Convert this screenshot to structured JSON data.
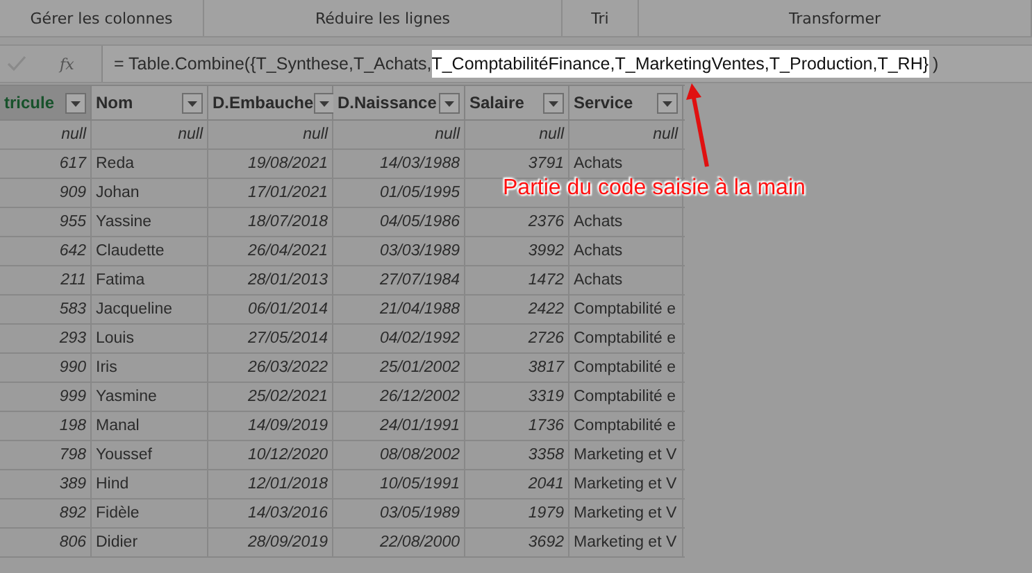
{
  "ribbon_groups": [
    "Gérer les colonnes",
    "Réduire les lignes",
    "Tri",
    "Transformer"
  ],
  "formula_bar": {
    "fx": "fx",
    "prefix": "= Table.Combine({T_Synthese,T_Achats,",
    "highlight": "T_ComptabilitéFinance,T_MarketingVentes,T_Production,T_RH}",
    "suffix": ")"
  },
  "table": {
    "columns": [
      {
        "label": "tricule",
        "selected": true
      },
      {
        "label": "Nom",
        "selected": false
      },
      {
        "label": "D.Embauche",
        "selected": false
      },
      {
        "label": "D.Naissance",
        "selected": false
      },
      {
        "label": "Salaire",
        "selected": false
      },
      {
        "label": "Service",
        "selected": false
      }
    ],
    "filter_row": [
      "null",
      "null",
      "null",
      "null",
      "null",
      "null"
    ],
    "rows": [
      [
        "617",
        "Reda",
        "19/08/2021",
        "14/03/1988",
        "3791",
        "Achats"
      ],
      [
        "909",
        "Johan",
        "17/01/2021",
        "01/05/1995",
        null,
        null
      ],
      [
        "955",
        "Yassine",
        "18/07/2018",
        "04/05/1986",
        "2376",
        "Achats"
      ],
      [
        "642",
        "Claudette",
        "26/04/2021",
        "03/03/1989",
        "3992",
        "Achats"
      ],
      [
        "211",
        "Fatima",
        "28/01/2013",
        "27/07/1984",
        "1472",
        "Achats"
      ],
      [
        "583",
        "Jacqueline",
        "06/01/2014",
        "21/04/1988",
        "2422",
        "Comptabilité e"
      ],
      [
        "293",
        "Louis",
        "27/05/2014",
        "04/02/1992",
        "2726",
        "Comptabilité e"
      ],
      [
        "990",
        "Iris",
        "26/03/2022",
        "25/01/2002",
        "3817",
        "Comptabilité e"
      ],
      [
        "999",
        "Yasmine",
        "25/02/2021",
        "26/12/2002",
        "3319",
        "Comptabilité e"
      ],
      [
        "198",
        "Manal",
        "14/09/2019",
        "24/01/1991",
        "1736",
        "Comptabilité e"
      ],
      [
        "798",
        "Youssef",
        "10/12/2020",
        "08/08/2002",
        "3358",
        "Marketing et V"
      ],
      [
        "389",
        "Hind",
        "12/01/2018",
        "10/05/1991",
        "2041",
        "Marketing et V"
      ],
      [
        "892",
        "Fidèle",
        "14/03/2016",
        "03/05/1989",
        "1979",
        "Marketing et V"
      ],
      [
        "806",
        "Didier",
        "28/09/2019",
        "22/08/2000",
        "3692",
        "Marketing et V"
      ]
    ]
  },
  "annotation": "Partie du code saisie à la main"
}
